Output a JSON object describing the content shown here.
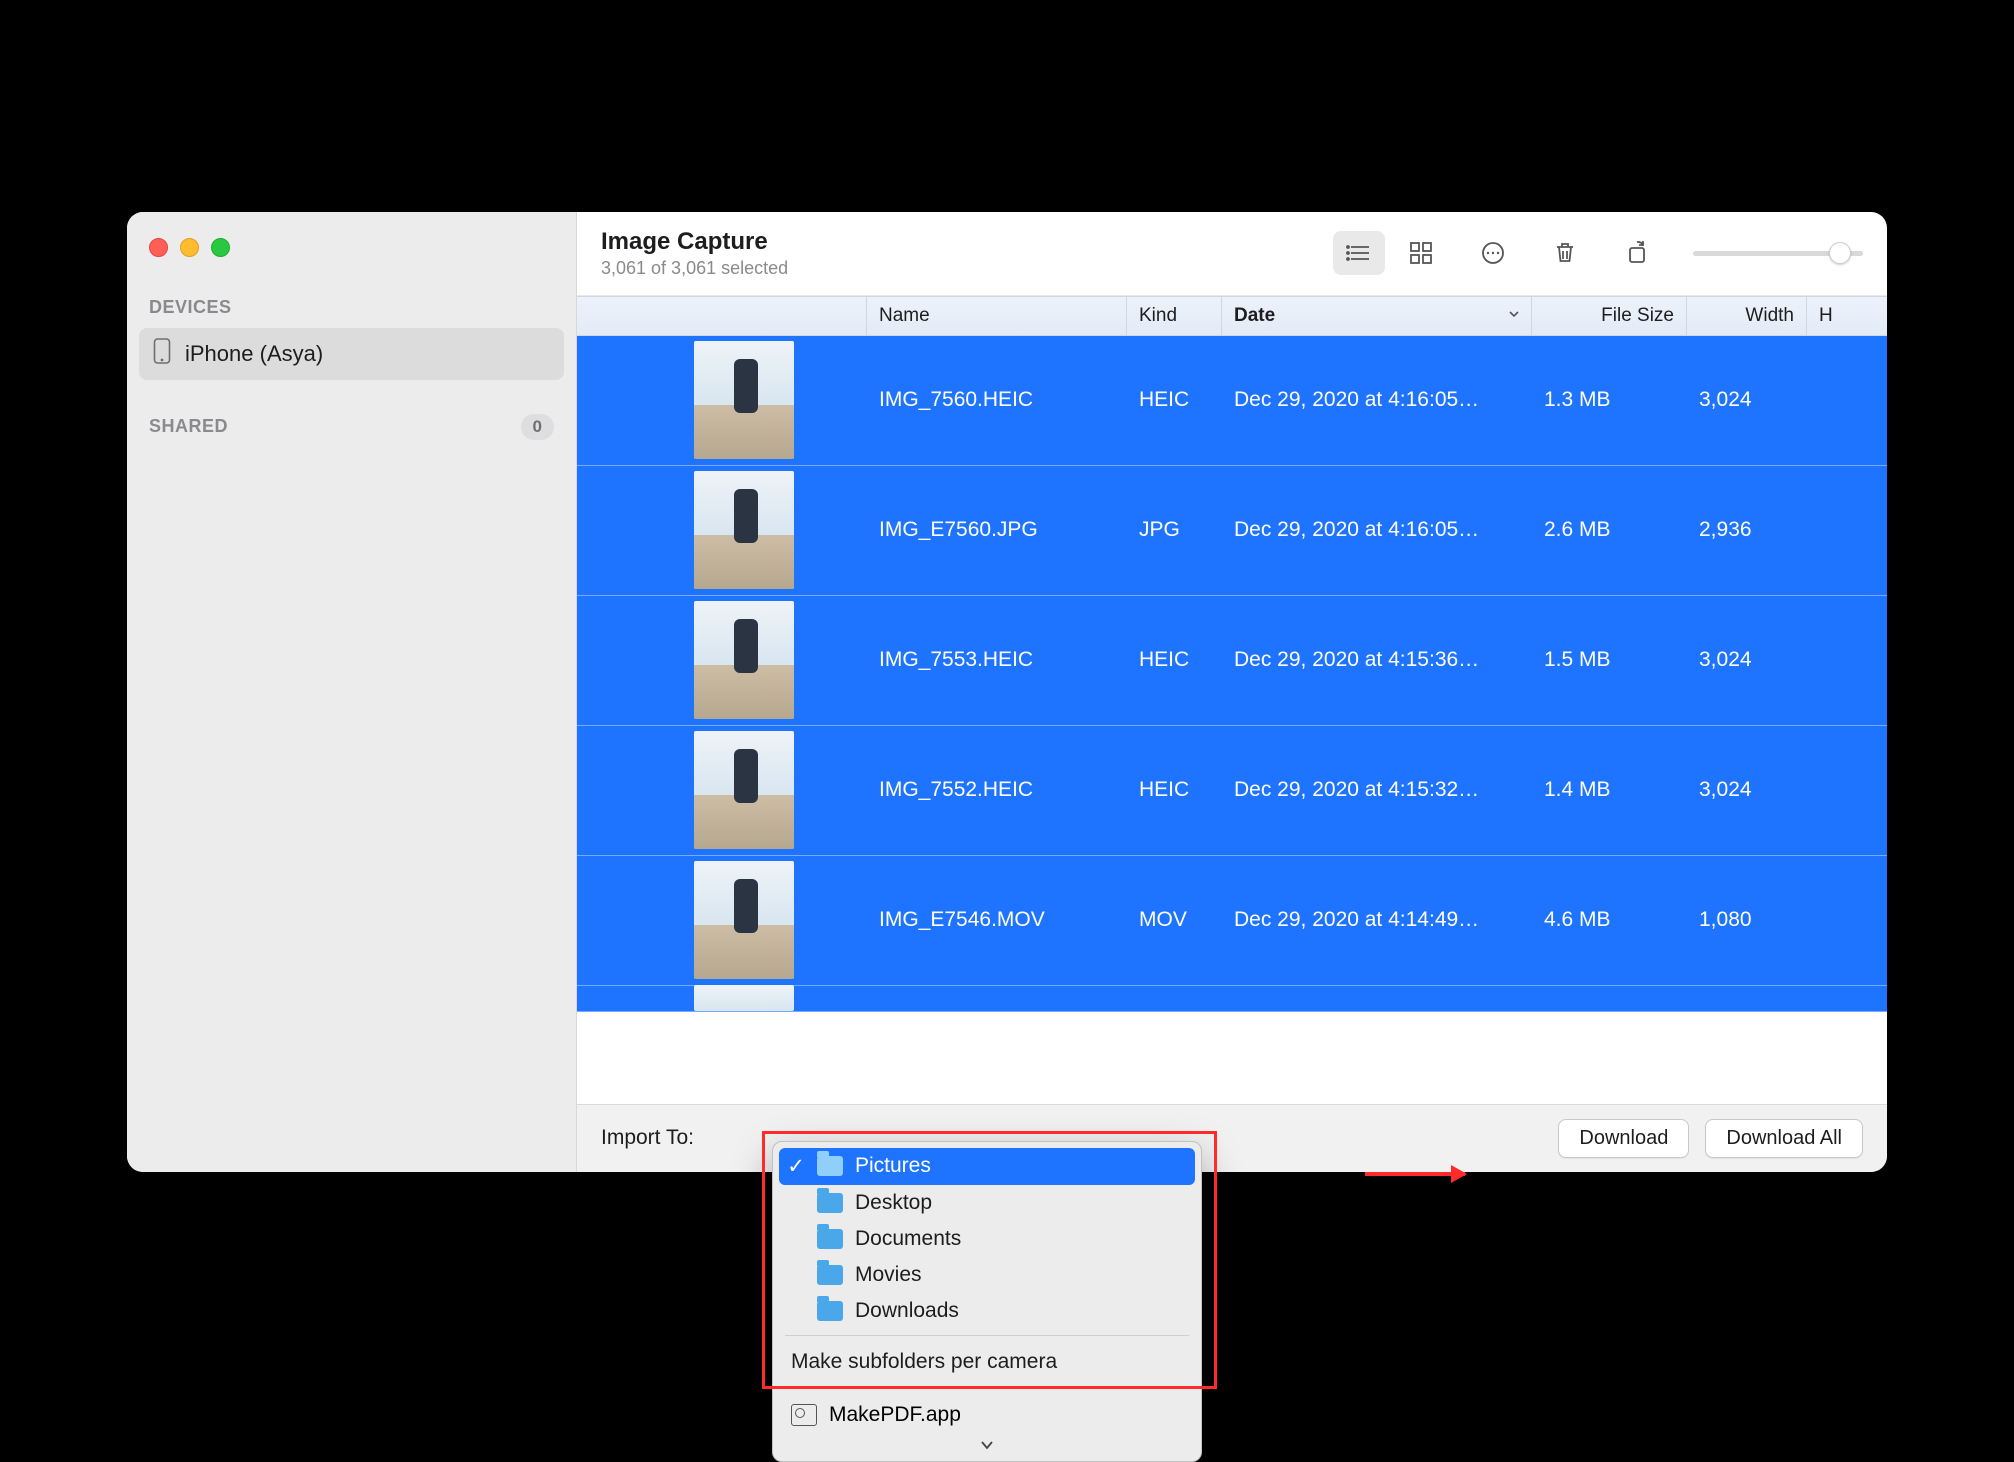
{
  "window": {
    "title": "Image Capture",
    "subtitle": "3,061 of 3,061 selected"
  },
  "sidebar": {
    "devices_heading": "DEVICES",
    "device_name": "iPhone (Asya)",
    "shared_heading": "SHARED",
    "shared_count": "0"
  },
  "columns": {
    "name": "Name",
    "kind": "Kind",
    "date": "Date",
    "size": "File Size",
    "width": "Width",
    "h": "H"
  },
  "rows": [
    {
      "name": "IMG_7560.HEIC",
      "kind": "HEIC",
      "date": "Dec 29, 2020 at 4:16:05…",
      "size": "1.3 MB",
      "width": "3,024"
    },
    {
      "name": "IMG_E7560.JPG",
      "kind": "JPG",
      "date": "Dec 29, 2020 at 4:16:05…",
      "size": "2.6 MB",
      "width": "2,936"
    },
    {
      "name": "IMG_7553.HEIC",
      "kind": "HEIC",
      "date": "Dec 29, 2020 at 4:15:36…",
      "size": "1.5 MB",
      "width": "3,024"
    },
    {
      "name": "IMG_7552.HEIC",
      "kind": "HEIC",
      "date": "Dec 29, 2020 at 4:15:32…",
      "size": "1.4 MB",
      "width": "3,024"
    },
    {
      "name": "IMG_E7546.MOV",
      "kind": "MOV",
      "date": "Dec 29, 2020 at 4:14:49…",
      "size": "4.6 MB",
      "width": "1,080"
    }
  ],
  "footer": {
    "import_label": "Import To:",
    "download": "Download",
    "download_all": "Download All"
  },
  "popup": {
    "items": [
      "Pictures",
      "Desktop",
      "Documents",
      "Movies",
      "Downloads"
    ],
    "selected_index": 0,
    "subfolders": "Make subfolders per camera",
    "app": "MakePDF.app"
  }
}
